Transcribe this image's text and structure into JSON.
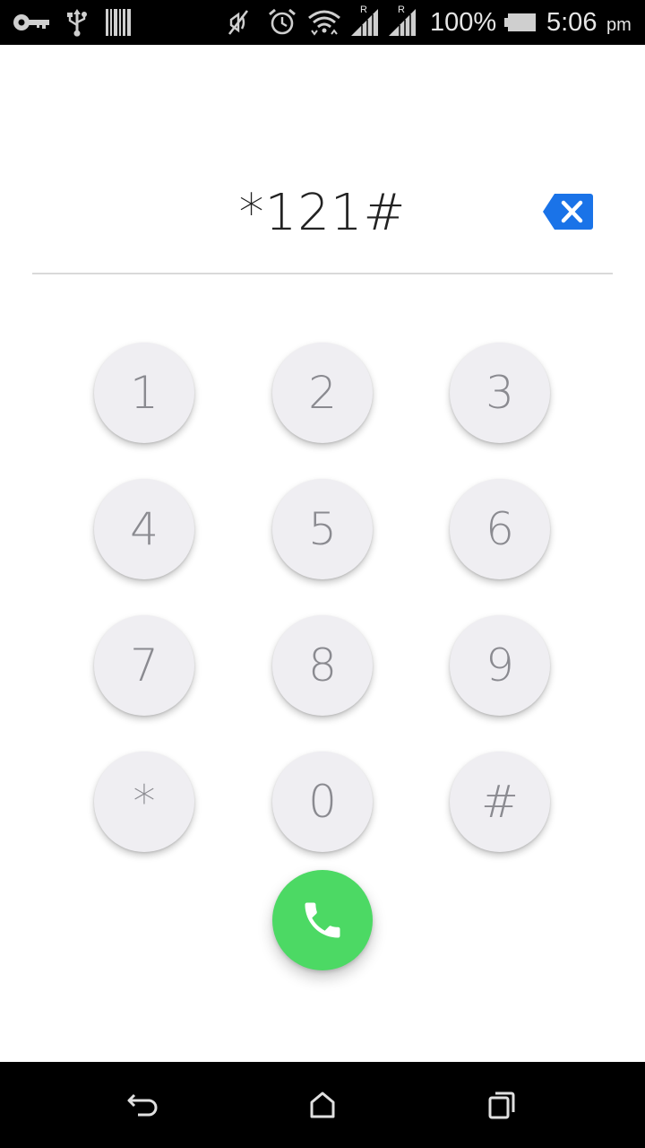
{
  "status_bar": {
    "battery_percent": "100%",
    "time": "5:06",
    "ampm": "pm",
    "icons": [
      "key-icon",
      "usb-icon",
      "barcode-icon",
      "mute-icon",
      "alarm-icon",
      "wifi-icon",
      "signal-r-icon",
      "signal-r-icon",
      "battery-icon"
    ],
    "roaming_label": "R"
  },
  "dialer": {
    "number": "*121#",
    "backspace_icon": "backspace-icon",
    "accent_color": "#1a73e8"
  },
  "keypad": {
    "keys": [
      "1",
      "2",
      "3",
      "4",
      "5",
      "6",
      "7",
      "8",
      "9",
      "*",
      "0",
      "#"
    ]
  },
  "call": {
    "icon": "phone-icon",
    "color": "#4cd964"
  },
  "nav_bar": {
    "icons": [
      "back-icon",
      "home-icon",
      "recents-icon"
    ]
  }
}
